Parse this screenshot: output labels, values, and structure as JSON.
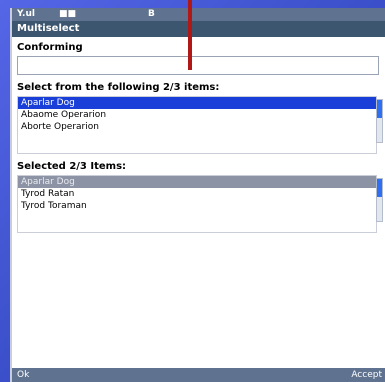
{
  "status": {
    "signal": "Y.ul",
    "battery": "■■",
    "center": "B"
  },
  "app": {
    "title": "Multiselect"
  },
  "form": {
    "field_label": "Conforming",
    "field_value": "",
    "available_label": "Select from the following 2/3 items:",
    "available_items": [
      "Aparlar Dog",
      "Abaome Operarion",
      "Aborte Operarion"
    ],
    "selected_label": "Selected 2/3 Items:",
    "selected_items": [
      "Aparlar Dog",
      "Tyrod Ratan",
      "Tyrod Toraman"
    ]
  },
  "footer": {
    "left": "Ok",
    "right": "Accept"
  }
}
